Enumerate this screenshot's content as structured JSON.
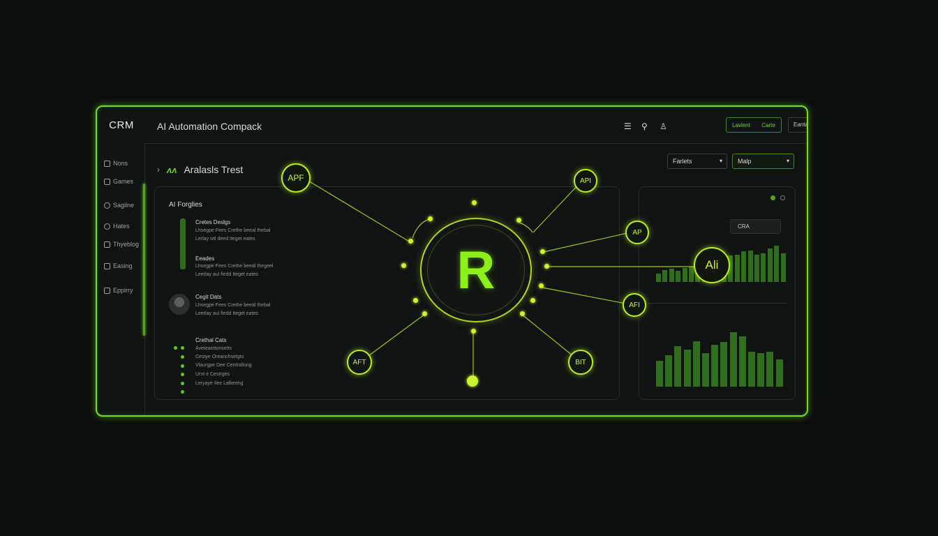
{
  "brand": "CRM",
  "app_title": "AI Automation Compack",
  "topbar": {
    "icons": [
      "menu-icon",
      "search-icon",
      "user-icon"
    ],
    "pill_left": "Lavlent",
    "pill_right": "Carte",
    "search_label": "Eantay"
  },
  "sidebar": {
    "items": [
      {
        "label": "Nons",
        "icon": "file-icon"
      },
      {
        "label": "Games",
        "icon": "grid-icon"
      },
      {
        "label": "Sagilne",
        "icon": "gear-icon"
      },
      {
        "label": "Hates",
        "icon": "clock-icon"
      },
      {
        "label": "Thyeblog",
        "icon": "chart-icon"
      },
      {
        "label": "Easing",
        "icon": "list-icon"
      },
      {
        "label": "Eppirry",
        "icon": "doc-icon"
      }
    ]
  },
  "breadcrumb": {
    "leaf": "Aralasls Trest"
  },
  "filters": {
    "select1": "Farlets",
    "select2": "Malp"
  },
  "left_panel": {
    "title": "AI Forglies",
    "entries": [
      {
        "heading": "Cretes Deslgs",
        "line1": "Lhsegpe Fees Crethe beeal thebal",
        "line2": "Lerlay wtl deed Iteget eates"
      },
      {
        "heading": "Eeades",
        "line1": "Lhsegpe Fees Crethe beeal thegeel",
        "line2": "Leerlay aul fiedd Iteget eates"
      },
      {
        "heading": "Cegit Dats",
        "line1": "Lhsegpe Fees Crethe beeal thebal",
        "line2": "Leerlay aul fiedd Iteget eates"
      }
    ],
    "checklist_title": "Crethal Cats",
    "checklist": [
      "Aveteanttonsetts",
      "Cestye Oreanchsetgts",
      "Vlaurgpe Dee Centrallong",
      "Urnt e Cestrges",
      "Leryaye Ilee Lalkeeng"
    ]
  },
  "center_graph": {
    "hub_letter": "R",
    "nodes": [
      "APF",
      "API",
      "AP",
      "Ali",
      "AFI",
      "AFT",
      "BIT"
    ]
  },
  "right_panel": {
    "tooltip": "CRA",
    "chart_top": [
      12,
      17,
      19,
      16,
      20,
      22,
      24,
      27,
      30,
      35,
      33,
      37,
      38,
      43,
      44,
      38,
      40,
      47,
      51,
      40
    ],
    "chart_bottom": [
      35,
      43,
      55,
      50,
      62,
      46,
      57,
      61,
      74,
      68,
      47,
      46,
      47,
      37
    ]
  },
  "colors": {
    "accent": "#6fe21a",
    "node": "#b8f01a",
    "bars": "#2f6e1c",
    "background": "#0c0d0d"
  }
}
